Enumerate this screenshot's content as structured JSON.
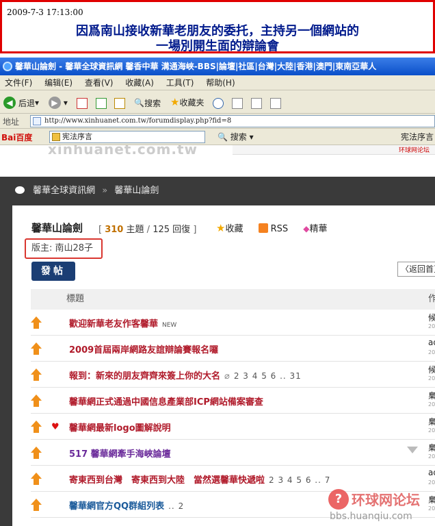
{
  "banner": {
    "timestamp": "2009-7-3 17:13:00",
    "line1": "因爲南山接收新華老朋友的委托，主持另一個網站的",
    "line2": "一場別開生面的辯論會"
  },
  "browser": {
    "title": "馨華山論劍 - 馨華全球資訊網 馨香中華 溝通海峽-BBS|論壇|社區|台灣|大陸|香港|澳門|東南亞華人",
    "menu": [
      "文件(F)",
      "编辑(E)",
      "查看(V)",
      "收藏(A)",
      "工具(T)",
      "帮助(H)"
    ],
    "toolbar": {
      "back": "后退",
      "search": "搜索",
      "favorites": "收藏夹"
    },
    "address_label": "地址",
    "url": "http://www.xinhuanet.com.tw/forumdisplay.php?fid=8",
    "baidu_logo": "Bai百度",
    "baidu_query": "宪法序言",
    "baidu_search": "搜索",
    "baidu_right": "宪法序言"
  },
  "page": {
    "watermark": "xinhuanet.com.tw",
    "ad_text": "环球网论坛",
    "breadcrumb": [
      "馨華全球資訊網",
      "馨華山論劍"
    ],
    "breadcrumb_sep": "»"
  },
  "forum": {
    "name": "馨華山論劍",
    "topics_count": "310",
    "topics_label": "主題",
    "replies_count": "125",
    "replies_label": "回復",
    "favorite": "收藏",
    "rss": "RSS",
    "digest": "精華",
    "moderator": "版主: 南山28子",
    "post_button": "發帖",
    "back_button": "返回首頁",
    "col_title": "標題",
    "col_author": "作"
  },
  "threads": [
    {
      "title": "歡迎新華老友作客馨華",
      "badge": "NEW",
      "author": "候",
      "date": "200"
    },
    {
      "title": "2009首屆兩岸網路友誼辯論賽報名囉",
      "author": "ad",
      "date": "200"
    },
    {
      "title": "報到：新來的朋友齊齊來簽上你的大名",
      "pages": "2 3 4 5 6 .. 31",
      "author": "候",
      "date": "200"
    },
    {
      "title": "馨華網正式通過中國信息產業部ICP網站備案審查",
      "author": "梟",
      "date": "200"
    },
    {
      "title": "馨華網最新logo圖解說明",
      "author": "梟",
      "date": "200"
    },
    {
      "title": "517 馨華網牽手海峽論壇",
      "author": "梟",
      "date": "200"
    },
    {
      "title": "寄東西到台灣　寄東西到大陸　當然選馨華快遞啦",
      "pages": "2 3 4 5 6 .. 7",
      "author": "ad",
      "date": "200"
    },
    {
      "title": "馨華網官方QQ群組列表",
      "pages": "2",
      "author": "梟",
      "date": "200"
    }
  ],
  "watermark_logo": {
    "cn": "环球网论坛",
    "url": "bbs.huanqiu.com"
  }
}
